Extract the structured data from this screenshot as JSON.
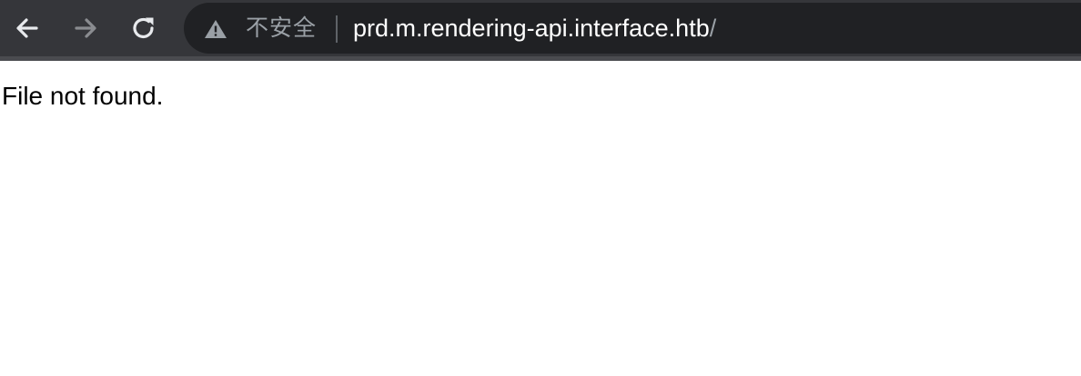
{
  "browser": {
    "security_label": "不安全",
    "url_host": "prd.m.rendering-api.interface.htb",
    "url_path": "/",
    "icons": {
      "back": "back-arrow-icon",
      "forward": "forward-arrow-icon",
      "reload": "reload-icon",
      "security": "warning-triangle-icon"
    }
  },
  "page": {
    "message": "File not found."
  },
  "colors": {
    "toolbar_bg": "#35363a",
    "omnibox_bg": "#202124",
    "url_text": "#ffffff",
    "muted_text": "#9aa0a6",
    "page_bg": "#ffffff"
  }
}
